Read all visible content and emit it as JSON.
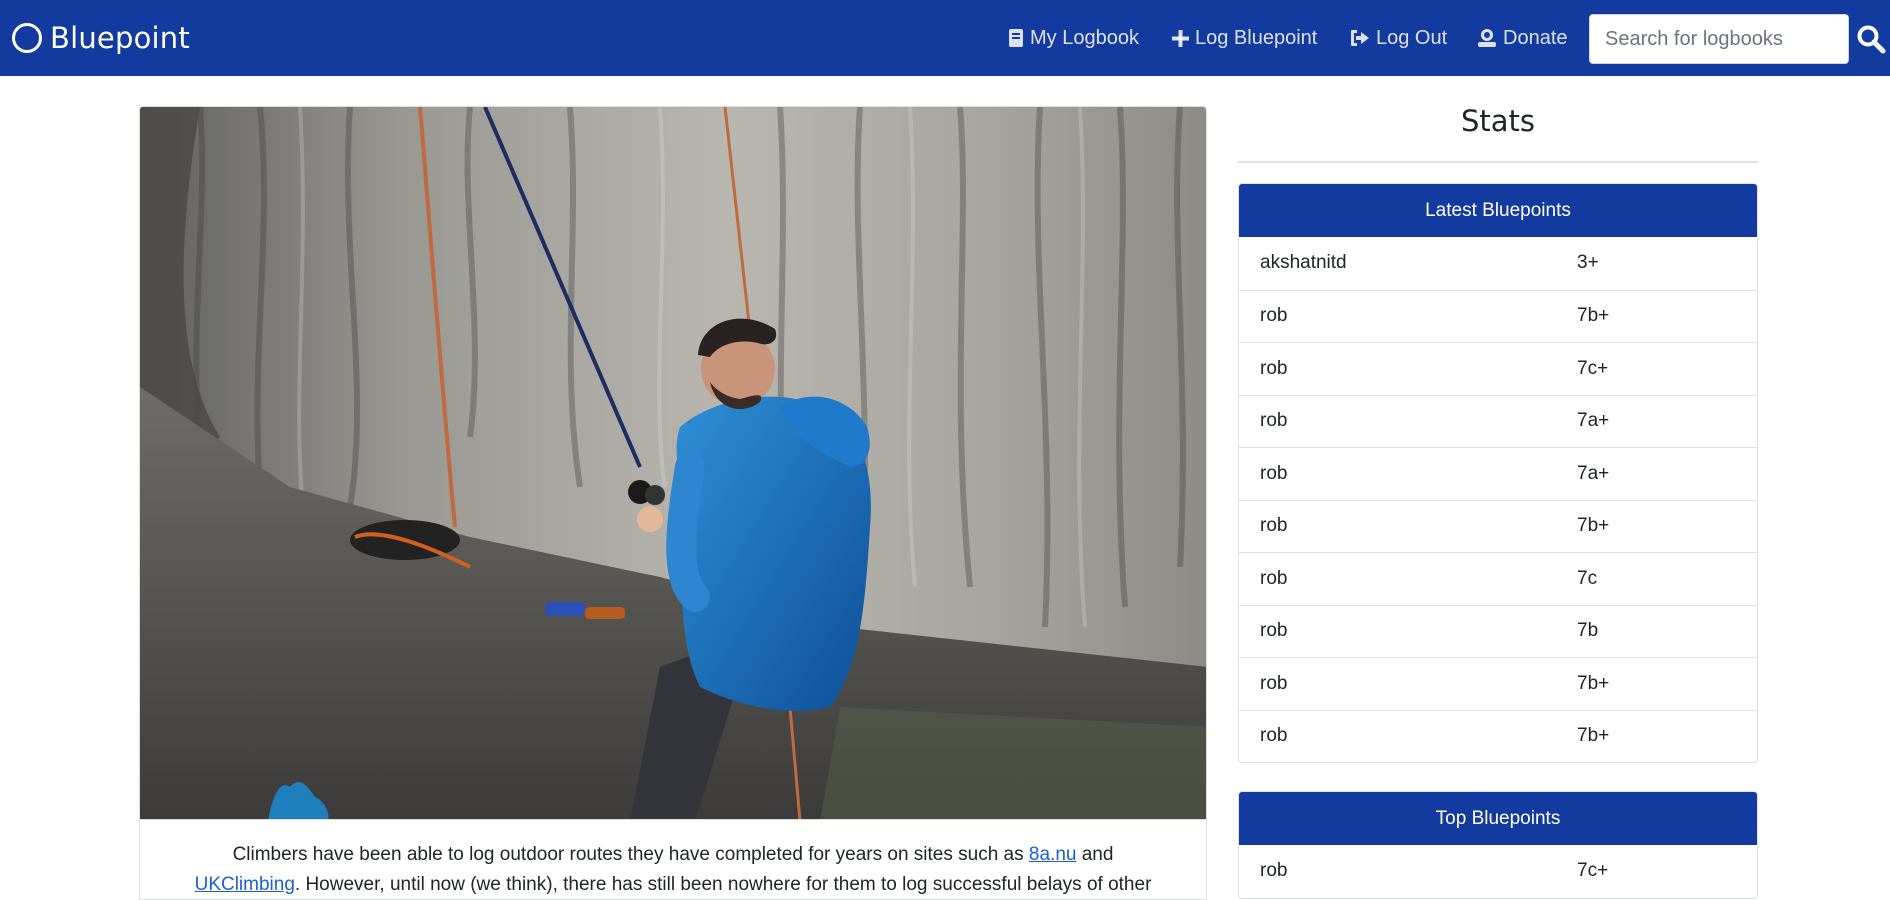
{
  "brand": {
    "name": "Bluepoint"
  },
  "nav": {
    "my_logbook": "My Logbook",
    "log_bluepoint": "Log Bluepoint",
    "log_out": "Log Out",
    "donate": "Donate"
  },
  "search": {
    "placeholder": "Search for logbooks"
  },
  "intro": {
    "part1": "Climbers have been able to log outdoor routes they have completed for years on sites such as ",
    "link1": "8a.nu",
    "part2": " and ",
    "link2": "UKClimbing",
    "part3": ". However, until now (we think), there has still been nowhere for them to log successful belays of other"
  },
  "stats": {
    "title": "Stats",
    "latest": {
      "header": "Latest Bluepoints",
      "rows": [
        {
          "user": "akshatnitd",
          "grade": "3+"
        },
        {
          "user": "rob",
          "grade": "7b+"
        },
        {
          "user": "rob",
          "grade": "7c+"
        },
        {
          "user": "rob",
          "grade": "7a+"
        },
        {
          "user": "rob",
          "grade": "7a+"
        },
        {
          "user": "rob",
          "grade": "7b+"
        },
        {
          "user": "rob",
          "grade": "7c"
        },
        {
          "user": "rob",
          "grade": "7b"
        },
        {
          "user": "rob",
          "grade": "7b+"
        },
        {
          "user": "rob",
          "grade": "7b+"
        }
      ]
    },
    "top": {
      "header": "Top Bluepoints",
      "rows": [
        {
          "user": "rob",
          "grade": "7c+"
        }
      ]
    }
  },
  "colors": {
    "navbar": "#133a9e",
    "link": "#1a5fd8"
  }
}
